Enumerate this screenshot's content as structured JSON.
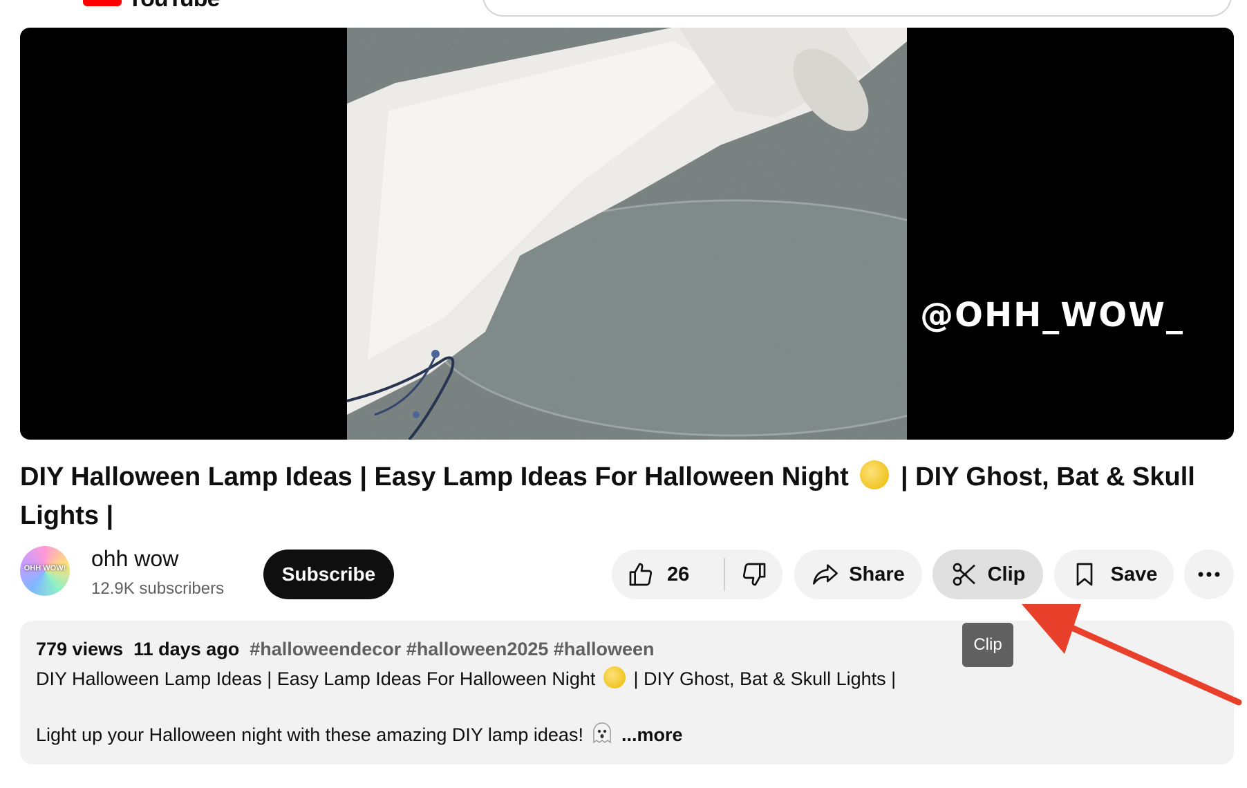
{
  "header": {
    "logo_text": "YouTube"
  },
  "video": {
    "watermark": "@OHH_WOW_"
  },
  "title": {
    "part1": "DIY Halloween Lamp Ideas | Easy Lamp Ideas For Halloween Night",
    "part2": "| DIY Ghost, Bat & Skull Lights |"
  },
  "channel": {
    "name": "ohh wow",
    "subscribers": "12.9K subscribers",
    "avatar_text": "OHH WOW!",
    "subscribe_label": "Subscribe"
  },
  "actions": {
    "like_count": "26",
    "share_label": "Share",
    "clip_label": "Clip",
    "save_label": "Save",
    "more_label": "..."
  },
  "tooltip": {
    "text": "Clip"
  },
  "description": {
    "views": "779 views",
    "age": "11 days ago",
    "hashtags": "#halloweendecor #halloween2025 #halloween",
    "line1_a": "DIY Halloween Lamp Ideas | Easy Lamp Ideas For Halloween Night",
    "line1_b": "| DIY Ghost, Bat & Skull Lights |",
    "line2": "Light up your Halloween night with these amazing DIY lamp ideas!",
    "more_label": "...more"
  },
  "colors": {
    "accent_red": "#e8402a",
    "subscribe_bg": "#0f0f0f",
    "pill_bg": "#f2f2f2"
  }
}
